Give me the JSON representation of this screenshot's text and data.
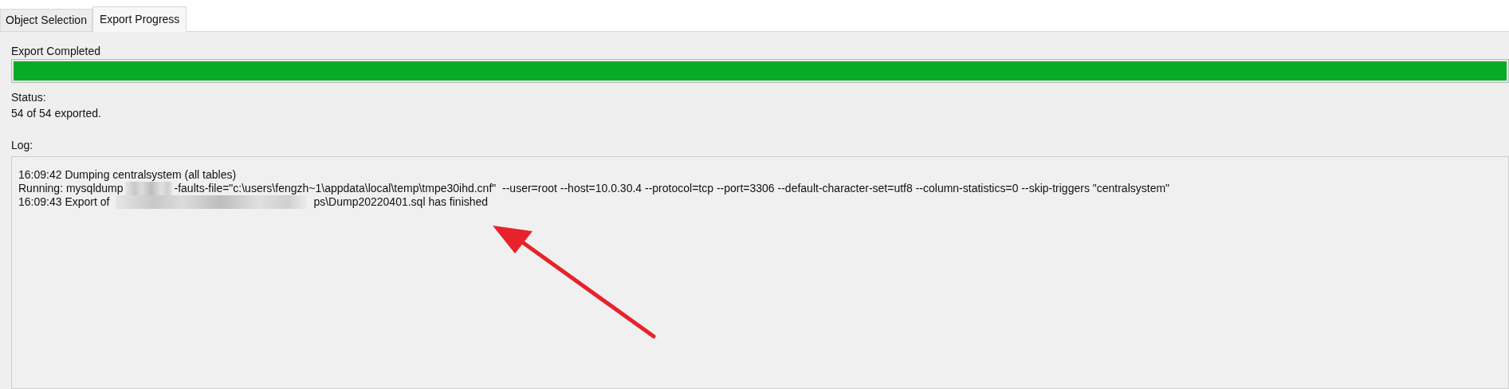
{
  "tabs": [
    {
      "label": "Object Selection",
      "selected": false
    },
    {
      "label": "Export Progress",
      "selected": true
    }
  ],
  "progress": {
    "label": "Export Completed",
    "level": 1
  },
  "status": {
    "label": "Status:",
    "value": "54 of 54 exported."
  },
  "log": {
    "label": "Log:",
    "lines": [
      {
        "segments": [
          {
            "kind": "text",
            "text": "16:09:42 Dumping centralsystem (all tables)"
          }
        ]
      },
      {
        "segments": [
          {
            "kind": "text",
            "text": "Running: mysqldump"
          },
          {
            "kind": "redacted"
          },
          {
            "kind": "text",
            "text": "-faults-file=\"c:\\users\\fengzh~1\\appdata\\local\\temp\\tmpe30ihd.cnf\"  --user=root --host=10.0.30.4 --protocol=tcp --port=3306 --default-character-set=utf8 --column-statistics=0 --skip-triggers \"centralsystem\""
          }
        ]
      },
      {
        "segments": [
          {
            "kind": "text",
            "text": "16:09:43 Export of"
          },
          {
            "kind": "redacted",
            "wide": true
          },
          {
            "kind": "text",
            "text": "ps\\Dump20220401.sql has finished"
          }
        ]
      }
    ]
  },
  "annotation": {
    "kind": "arrow",
    "color": "#e8222a"
  }
}
